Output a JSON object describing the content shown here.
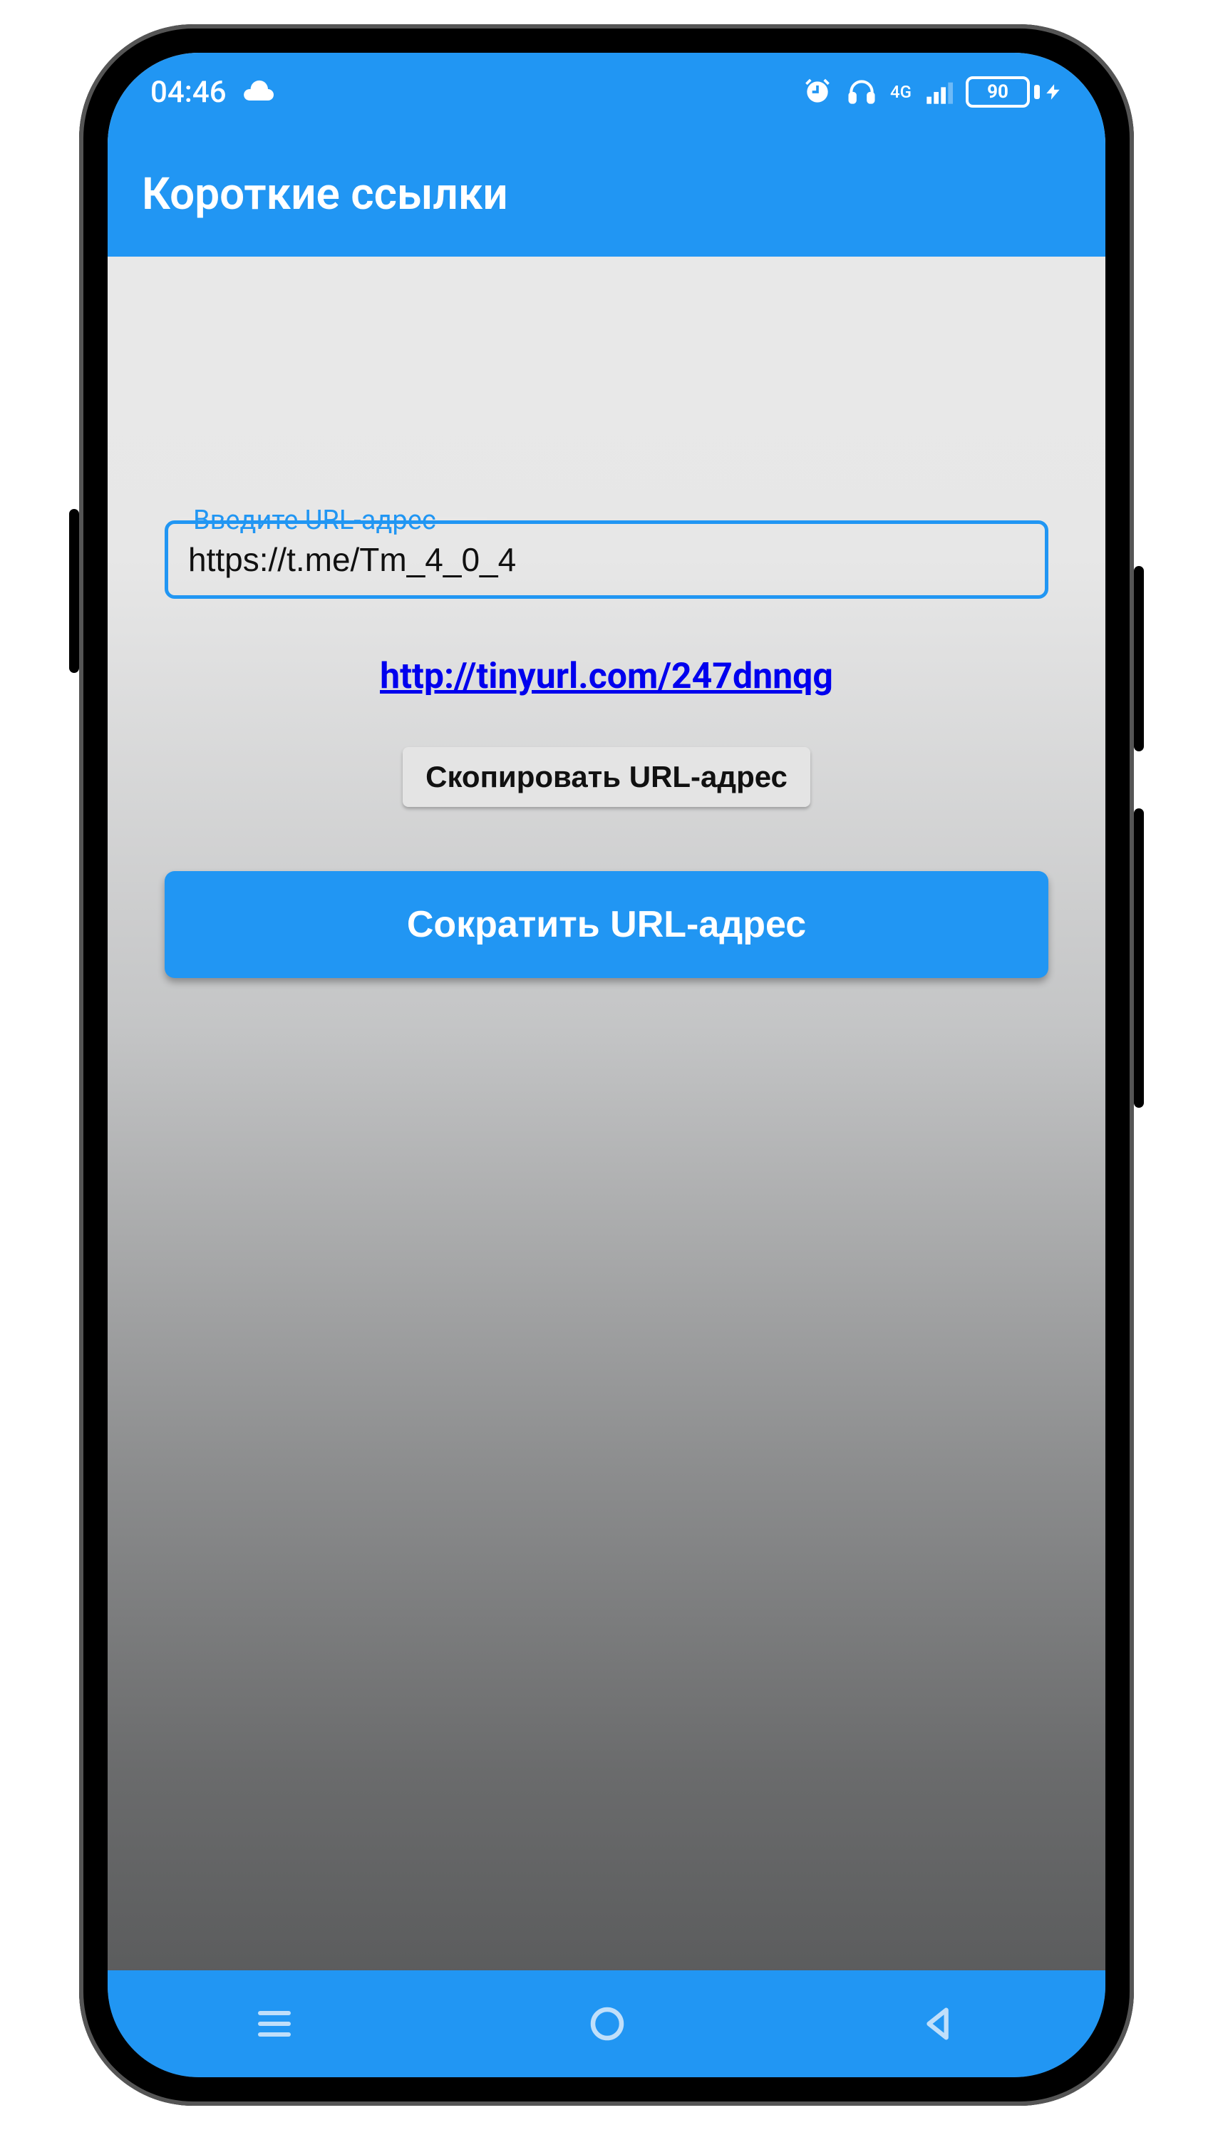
{
  "statusbar": {
    "time": "04:46",
    "battery_percent": "90",
    "network_label": "4G"
  },
  "appbar": {
    "title": "Короткие ссылки"
  },
  "form": {
    "url_label": "Введите URL-адрес",
    "url_value": "https://t.me/Tm_4_0_4",
    "result_link": "http://tinyurl.com/247dnnqg",
    "copy_button": "Скопировать URL-адрес",
    "shorten_button": "Сократить URL-адрес"
  },
  "colors": {
    "accent": "#2196f3"
  }
}
